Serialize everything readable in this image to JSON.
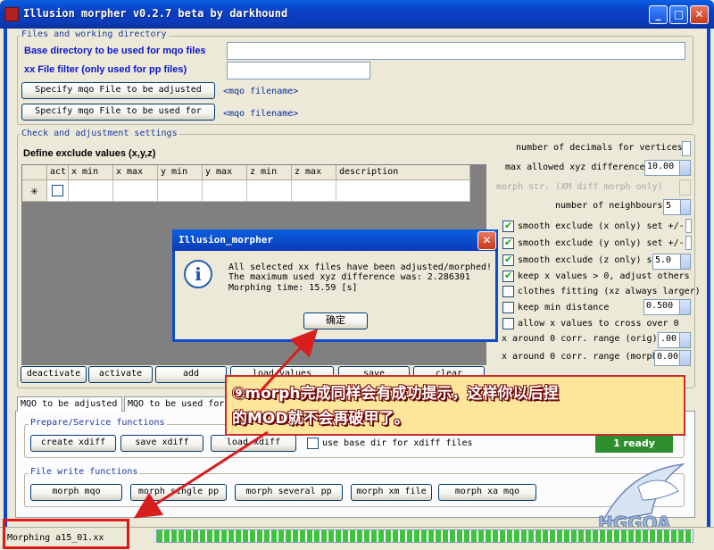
{
  "window": {
    "title": "Illusion morpher v0.2.7 beta by darkhound"
  },
  "files_group": {
    "title": "Files and working directory",
    "base_dir_label": "Base directory to be used  for mqo files",
    "filter_label": "xx File filter (only used for pp files)",
    "specify_adjusted_button": "Specify mqo File to be adjusted",
    "specify_used_for_button": "Specify mqo File to be used for",
    "filename_placeholder_1": "<mqo filename>",
    "filename_placeholder_2": "<mqo filename>"
  },
  "check_group": {
    "title": "Check and adjustment settings",
    "exclude_label": "Define exclude values (x,y,z)",
    "columns": [
      "act",
      "x min",
      "x max",
      "y min",
      "y max",
      "z min",
      "z max",
      "description"
    ],
    "new_row_marker": "✳"
  },
  "settings": {
    "decimals_label": "number of decimals for vertices",
    "max_diff_label": "max allowed xyz difference",
    "max_diff_value": "10.00",
    "morph_str_label": "morph str. (XM diff morph only)",
    "neighbours_label": "number of neighbours",
    "neighbours_value": "5",
    "smooth_x_label": "smooth exclude (x only) set +/-",
    "smooth_y_label": "smooth exclude (y only) set +/-",
    "smooth_z_label": "smooth exclude (z only) s",
    "smooth_z_value": "5.0",
    "keep_x_label": "keep x values > 0, adjust others",
    "clothes_label": "clothes fitting (xz always larger)",
    "keep_min_label": "keep min distance",
    "keep_min_value": "0.500",
    "allow_x_label": "allow x values to cross over 0",
    "x_around_orig_label": "x around 0 corr. range (orig)",
    "x_around_orig_value": ".00",
    "x_around_morph_label": "x around 0 corr. range (morph",
    "x_around_morph_value": "0.00"
  },
  "grid_buttons": [
    "deactivate",
    "activate",
    "add",
    "load/values",
    "save",
    "clear"
  ],
  "tabs": [
    "MQO to be adjusted",
    "MQO to be used for"
  ],
  "prepare_group": {
    "title": "Prepare/Service functions",
    "buttons": [
      "create xdiff",
      "save xdiff",
      "load xdiff"
    ],
    "use_base_dir_label": "use base dir for xdiff files",
    "ready_badge": "1 ready"
  },
  "file_write_group": {
    "title": "File write functions",
    "buttons": [
      "morph mqo",
      "morph single pp",
      "morph several pp",
      "morph xm file",
      "morph xa mqo"
    ]
  },
  "dialog": {
    "title": "Illusion_morpher",
    "line1": "All selected xx files have been adjusted/morphed!",
    "line2": "The maximum used xyz difference was: 2.286301",
    "line3": "Morphing time: 15.59 [s]",
    "ok_button": "确定"
  },
  "annotation": {
    "line1": "⑨morph完成同样会有成功提示，这样你以后捏",
    "line2": "的MOD就不会再破甲了。"
  },
  "status": {
    "text": "Morphing a15_01.xx",
    "progress": 1.0
  },
  "colors": {
    "accent": "#0a46d0",
    "annotation_border": "#c62c2c",
    "progress": "#3fc33f",
    "ready_badge": "#2f8f2f"
  }
}
